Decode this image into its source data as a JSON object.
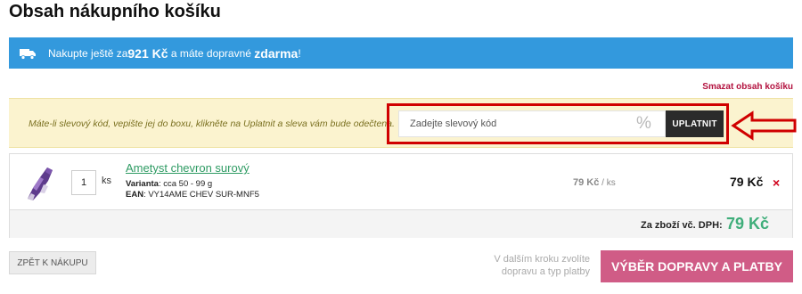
{
  "page": {
    "title": "Obsah nákupního košíku"
  },
  "shipping_banner": {
    "icon": "truck-icon",
    "text_before": "Nakupte ještě za ",
    "amount": "921 Kč",
    "text_middle": " a máte dopravné ",
    "free_word": "zdarma",
    "text_after": "!"
  },
  "clear_cart_label": "Smazat obsah košíku",
  "coupon": {
    "hint": "Máte-li slevový kód, vepište jej do boxu, klikněte na Uplatnit a sleva vám bude odečtena.",
    "placeholder": "Zadejte slevový kód",
    "value": "",
    "percent_symbol": "%",
    "apply_label": "UPLATNIT"
  },
  "cart": {
    "item": {
      "name": "Ametyst chevron surový",
      "quantity": "1",
      "unit": "ks",
      "variant_label": "Varianta",
      "variant_value": ": cca 50 - 99 g",
      "ean_label": "EAN",
      "ean_value": ": VY14AME CHEV SUR-MNF5",
      "unit_price": "79 Kč",
      "unit_price_suffix": " / ks",
      "total_price": "79 Kč",
      "remove_symbol": "×"
    },
    "total_label": "Za zboží vč. DPH:",
    "total_value": "79 Kč"
  },
  "footer": {
    "back_label": "ZPĚT K NÁKUPU",
    "next_hint": "V dalším kroku zvolíte dopravu a typ platby",
    "next_label": "VÝBĚR DOPRAVY A PLATBY"
  },
  "colors": {
    "banner": "#3399dd",
    "coupon_bg": "#fbf3cf",
    "annotation_red": "#d00000",
    "product_link": "#2e9b63",
    "total_green": "#3fae7a",
    "cta": "#d05c86"
  }
}
